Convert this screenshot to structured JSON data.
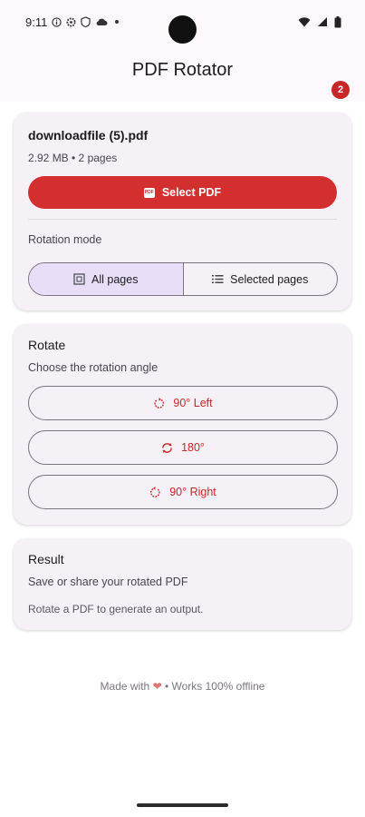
{
  "status_bar": {
    "time": "9:11",
    "icons": [
      "info-icon",
      "settings-icon",
      "shield-icon",
      "cloud-icon",
      "dot-icon",
      "wifi-icon",
      "signal-icon",
      "battery-icon"
    ]
  },
  "header": {
    "title": "PDF Rotator",
    "badge": "2"
  },
  "file_card": {
    "file_name": "downloadfile (5).pdf",
    "file_meta": "2.92 MB • 2 pages",
    "select_label": "Select PDF",
    "mode_label": "Rotation mode",
    "modes": [
      {
        "label": "All pages",
        "active": true,
        "icon": "grid-icon"
      },
      {
        "label": "Selected pages",
        "active": false,
        "icon": "list-icon"
      }
    ]
  },
  "rotate_card": {
    "title": "Rotate",
    "subtitle": "Choose the rotation angle",
    "buttons": [
      {
        "label": "90° Left",
        "icon": "rotate-left-icon"
      },
      {
        "label": "180°",
        "icon": "rotate-180-icon"
      },
      {
        "label": "90° Right",
        "icon": "rotate-right-icon"
      }
    ]
  },
  "result_card": {
    "title": "Result",
    "subtitle": "Save or share your rotated PDF",
    "note": "Rotate a PDF to generate an output."
  },
  "footer": {
    "prefix": "Made with",
    "suffix": "• Works 100% offline"
  },
  "colors": {
    "accent": "#d32f2f",
    "segment_active": "#e8def8",
    "card": "#f5f1f6"
  }
}
